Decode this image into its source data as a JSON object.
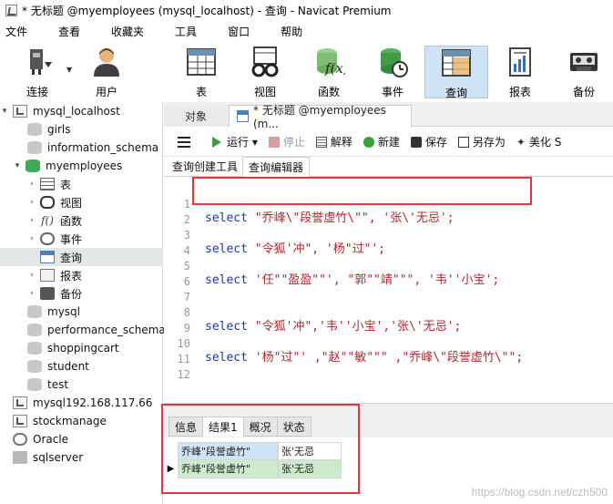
{
  "window": {
    "title": "* 无标题 @myemployees (mysql_localhost) - 查询 - Navicat Premium"
  },
  "menubar": [
    "文件",
    "查看",
    "收藏夹",
    "工具",
    "窗口",
    "帮助"
  ],
  "toolbar": {
    "buttons": [
      {
        "label": "连接",
        "icon": "plug-icon"
      },
      {
        "label": "用户",
        "icon": "user-icon"
      },
      {
        "label": "表",
        "icon": "table-icon"
      },
      {
        "label": "视图",
        "icon": "glasses-icon"
      },
      {
        "label": "函数",
        "icon": "function-icon"
      },
      {
        "label": "事件",
        "icon": "event-icon"
      },
      {
        "label": "查询",
        "icon": "query-icon",
        "active": true
      },
      {
        "label": "报表",
        "icon": "report-icon"
      },
      {
        "label": "备份",
        "icon": "backup-icon"
      }
    ]
  },
  "sidebar": {
    "items": [
      {
        "label": "mysql_localhost",
        "chevron": "▾",
        "icon": "server-icon"
      },
      {
        "label": "girls",
        "icon": "database-icon"
      },
      {
        "label": "information_schema",
        "icon": "database-icon"
      },
      {
        "label": "myemployees",
        "chevron": "▾",
        "icon": "database-icon"
      },
      {
        "label": "表",
        "chevron": "›",
        "icon": "table-icon"
      },
      {
        "label": "视图",
        "chevron": "›",
        "icon": "view-icon"
      },
      {
        "label": "函数",
        "chevron": "›",
        "icon": "function-icon"
      },
      {
        "label": "事件",
        "chevron": "›",
        "icon": "event-icon"
      },
      {
        "label": "查询",
        "icon": "query-icon",
        "selected": true
      },
      {
        "label": "报表",
        "chevron": "›",
        "icon": "report-icon"
      },
      {
        "label": "备份",
        "chevron": "›",
        "icon": "backup-icon"
      },
      {
        "label": "mysql",
        "icon": "database-icon"
      },
      {
        "label": "performance_schema",
        "icon": "database-icon"
      },
      {
        "label": "shoppingcart",
        "icon": "database-icon"
      },
      {
        "label": "student",
        "icon": "database-icon"
      },
      {
        "label": "test",
        "icon": "database-icon"
      },
      {
        "label": "mysql192.168.117.66",
        "icon": "server-icon"
      },
      {
        "label": "stockmanage",
        "icon": "server-icon"
      },
      {
        "label": "Oracle",
        "icon": "oracle-icon"
      },
      {
        "label": "sqlserver",
        "icon": "sqlserver-icon"
      }
    ]
  },
  "tabs": {
    "object": "对象",
    "query": "* 无标题 @myemployees (m..."
  },
  "query_toolbar": {
    "run": "运行 ▾",
    "stop": "停止",
    "explain": "解释",
    "new": "新建",
    "save": "保存",
    "saveas": "另存为",
    "beautify": "美化 S"
  },
  "subtabs": {
    "builder": "查询创建工具",
    "editor": "查询编辑器"
  },
  "editor": {
    "lines": [
      {
        "no": "1",
        "kw": "select",
        "rest": " \"乔峰\\\"段誉虚竹\\\"\", '张\\'无忌';"
      },
      {
        "no": "2",
        "kw": "",
        "rest": ""
      },
      {
        "no": "3",
        "kw": "select",
        "rest": " \"令狐'冲\", '杨\"过\"';"
      },
      {
        "no": "4",
        "kw": "",
        "rest": ""
      },
      {
        "no": "5",
        "kw": "select",
        "rest": " '任\"\"盈盈\"\"', \"郭\"\"靖\"\"\", '韦''小宝';"
      },
      {
        "no": "6",
        "kw": "",
        "rest": ""
      },
      {
        "no": "7",
        "kw": "",
        "rest": ""
      },
      {
        "no": "8",
        "kw": "select",
        "rest": " \"令狐'冲\",'韦''小宝','张\\'无忌';"
      },
      {
        "no": "9",
        "kw": "",
        "rest": ""
      },
      {
        "no": "10",
        "kw": "select",
        "rest": " '杨\"过\"' ,\"赵\"\"敏\"\"\" ,\"乔峰\\\"段誉虚竹\\\"\";"
      },
      {
        "no": "11",
        "kw": "",
        "rest": ""
      },
      {
        "no": "12",
        "kw": "",
        "rest": ""
      }
    ]
  },
  "results": {
    "tabs": [
      "信息",
      "结果1",
      "概况",
      "状态"
    ],
    "active_tab": "结果1",
    "rows": [
      {
        "marker": "",
        "cells": [
          "乔峰\"段誉虚竹\"",
          "张'无忌"
        ]
      },
      {
        "marker": "▶",
        "cells": [
          "乔峰\"段誉虚竹\"",
          "张'无忌"
        ]
      }
    ]
  },
  "watermark": "https://blog.csdn.net/czh500"
}
